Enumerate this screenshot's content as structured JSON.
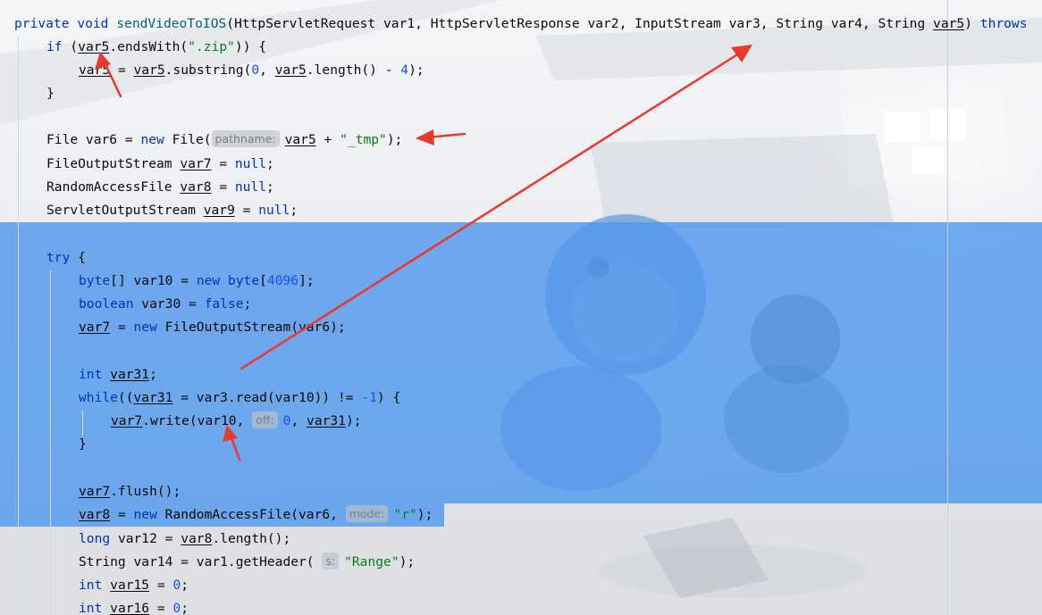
{
  "code": {
    "l1": {
      "kw1": "private",
      "kw2": "void",
      "method": "sendVideoToIOS",
      "params": "(HttpServletRequest var1, HttpServletResponse var2, InputStream var3, String var4, String ",
      "var5": "var5",
      "close": ") ",
      "throws": "throws"
    },
    "l2": {
      "if": "if",
      "a": " (",
      "v": "var5",
      "b": ".endsWith(",
      "s": "\".zip\"",
      "c": ")) {"
    },
    "l3": {
      "v1": "var5",
      "a": " = ",
      "v2": "var5",
      "b": ".substring(",
      "n0": "0",
      "c": ", ",
      "v3": "var5",
      "d": ".length() - ",
      "n4": "4",
      "e": ");"
    },
    "l4": {
      "t": "}"
    },
    "l6": {
      "a": "File var6 = ",
      "new": "new",
      "b": " File(",
      "hint": "pathname:",
      "v": "var5",
      "c": " + ",
      "s": "\"_tmp\"",
      "d": ");"
    },
    "l7": {
      "a": "FileOutputStream ",
      "v": "var7",
      "b": " = ",
      "null": "null",
      "c": ";"
    },
    "l8": {
      "a": "RandomAccessFile ",
      "v": "var8",
      "b": " = ",
      "null": "null",
      "c": ";"
    },
    "l9": {
      "a": "ServletOutputStream ",
      "v": "var9",
      "b": " = ",
      "null": "null",
      "c": ";"
    },
    "l11": {
      "try": "try",
      "a": " {"
    },
    "l12": {
      "byte1": "byte",
      "a": "[] var10 = ",
      "new": "new",
      "b": " ",
      "byte2": "byte",
      "c": "[",
      "n": "4096",
      "d": "];"
    },
    "l13": {
      "bool": "boolean",
      "a": " var30 = ",
      "false": "false",
      "b": ";"
    },
    "l14": {
      "v": "var7",
      "a": " = ",
      "new": "new",
      "b": " FileOutputStream(var6);"
    },
    "l16": {
      "int": "int",
      "a": " ",
      "v": "var31",
      "b": ";"
    },
    "l17": {
      "while": "while",
      "a": "((",
      "v": "var31",
      "b": " = var3.read(var10)) != ",
      "n": "-1",
      "c": ") {"
    },
    "l18": {
      "v": "var7",
      "a": ".write(var10, ",
      "hint": "off:",
      "n": "0",
      "b": ", ",
      "v2": "var31",
      "c": ");"
    },
    "l19": {
      "t": "}"
    },
    "l21": {
      "v": "var7",
      "a": ".flush();"
    },
    "l22": {
      "v": "var8",
      "a": " = ",
      "new": "new",
      "b": " RandomAccessFile(var6, ",
      "hint": "mode:",
      "s": "\"r\"",
      "c": ");"
    },
    "l23": {
      "long": "long",
      "a": " var12 = ",
      "v": "var8",
      "b": ".length();"
    },
    "l24": {
      "a": "String var14 = var1.getHeader( ",
      "hint": "s:",
      "s": "\"Range\"",
      "b": ");"
    },
    "l25": {
      "int": "int",
      "a": " ",
      "v": "var15",
      "b": " = ",
      "n": "0",
      "c": ";"
    },
    "l26": {
      "int": "int",
      "a": " ",
      "v": "var16",
      "b": " = ",
      "n": "0",
      "c": ";"
    }
  },
  "colors": {
    "keyword": "#0033b3",
    "method": "#00627a",
    "string": "#067d17",
    "number": "#1750eb",
    "selection": "#5297ec",
    "arrow": "#e8392f"
  },
  "icons": [
    "annotation-arrow"
  ]
}
